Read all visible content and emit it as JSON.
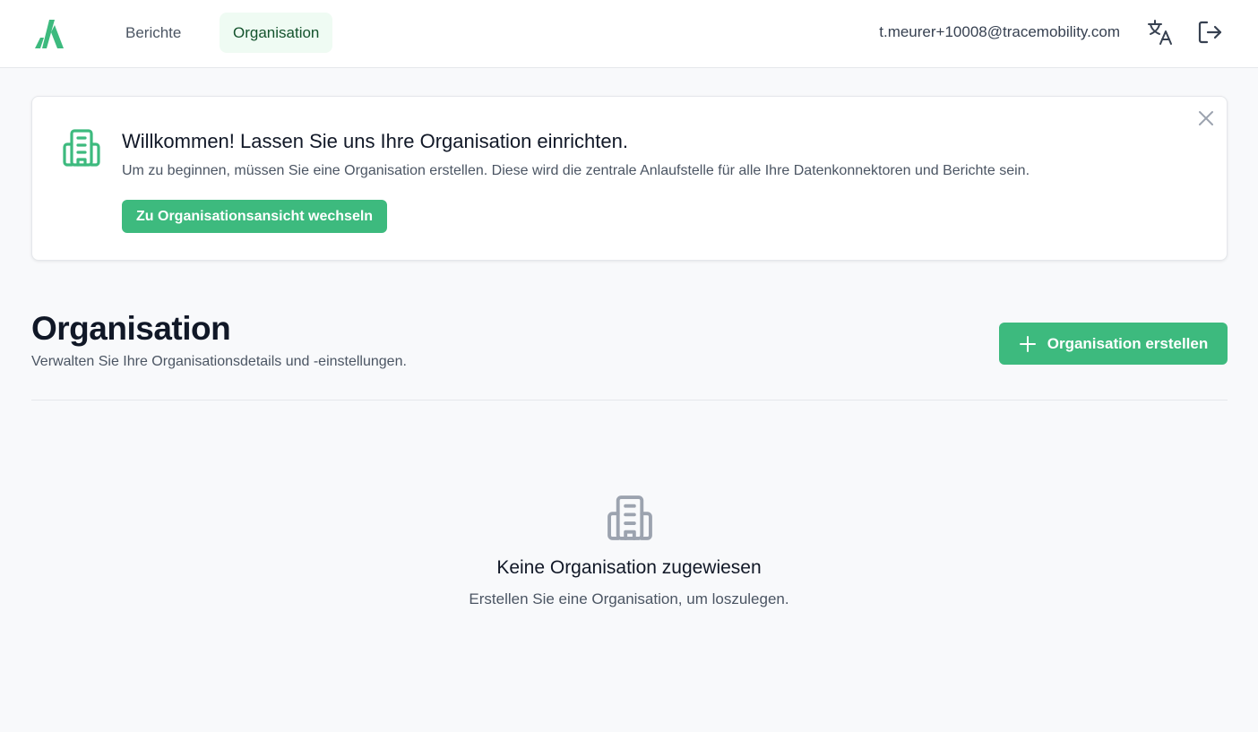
{
  "nav": {
    "items": [
      {
        "label": "Berichte"
      },
      {
        "label": "Organisation"
      }
    ],
    "user_email": "t.meurer+10008@tracemobility.com",
    "icons": {
      "logo": "brand-logo",
      "translate": "translate-icon",
      "logout": "logout-icon"
    }
  },
  "banner": {
    "title": "Willkommen! Lassen Sie uns Ihre Organisation einrichten.",
    "text": "Um zu beginnen, müssen Sie eine Organisation erstellen. Diese wird die zentrale Anlaufstelle für alle Ihre Datenkonnektoren und Berichte sein.",
    "button_label": "Zu Organisationsansicht wechseln"
  },
  "page": {
    "title": "Organisation",
    "subtitle": "Verwalten Sie Ihre Organisationsdetails und -einstellungen.",
    "create_button_label": "Organisation erstellen"
  },
  "empty_state": {
    "title": "Keine Organisation zugewiesen",
    "text": "Erstellen Sie eine Organisation, um loszulegen."
  },
  "colors": {
    "accent": "#3dba7e",
    "active_nav_bg": "#effbf3",
    "muted_icon": "#9ca3af"
  }
}
